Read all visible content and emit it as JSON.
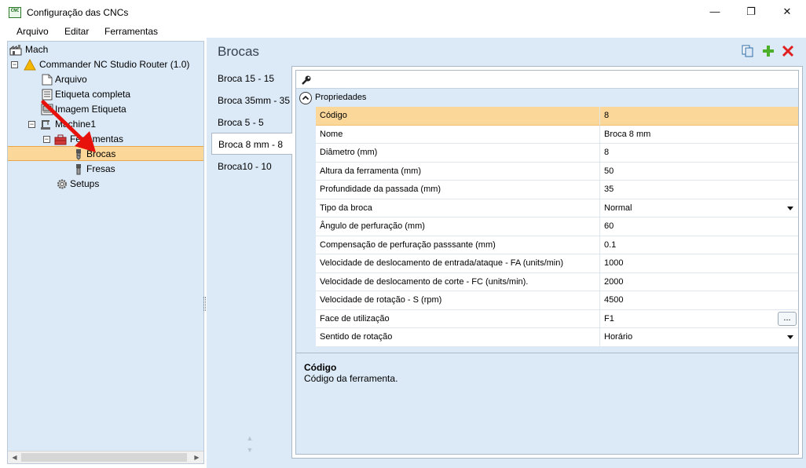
{
  "window": {
    "title": "Configuração das CNCs",
    "app_icon_label": "CNC",
    "minimize": "—",
    "maximize": "❐",
    "close": "✕"
  },
  "menu": {
    "items": [
      "Arquivo",
      "Editar",
      "Ferramentas"
    ]
  },
  "tree": {
    "root": "Mach",
    "machine_group": "Commander NC Studio Router (1.0)",
    "arquivo": "Arquivo",
    "etiqueta_completa": "Etiqueta completa",
    "imagem_etiqueta": "Imagem Etiqueta",
    "machine": "Machine1",
    "ferramentas": "Ferramentas",
    "brocas": "Brocas",
    "fresas": "Fresas",
    "setups": "Setups",
    "expander_minus": "−"
  },
  "header": {
    "title": "Brocas"
  },
  "tabs": [
    {
      "label": "Broca 15 - 15"
    },
    {
      "label": "Broca 35mm - 35"
    },
    {
      "label": "Broca 5 - 5"
    },
    {
      "label": "Broca 8 mm - 8",
      "active": true
    },
    {
      "label": "Broca10 - 10"
    }
  ],
  "property_grid": {
    "section": "Propriedades",
    "rows": [
      {
        "name": "Código",
        "value": "8",
        "selected": true
      },
      {
        "name": "Nome",
        "value": "Broca 8 mm"
      },
      {
        "name": "Diâmetro (mm)",
        "value": "8"
      },
      {
        "name": "Altura da ferramenta (mm)",
        "value": "50"
      },
      {
        "name": "Profundidade da passada (mm)",
        "value": "35"
      },
      {
        "name": "Tipo da broca",
        "value": "Normal",
        "editor": "dropdown"
      },
      {
        "name": "Ângulo de perfuração (mm)",
        "value": "60"
      },
      {
        "name": "Compensação de perfuração passsante (mm)",
        "value": "0.1"
      },
      {
        "name": "Velocidade de deslocamento de entrada/ataque - FA (units/min)",
        "value": "1000"
      },
      {
        "name": "Velocidade de deslocamento de corte - FC (units/min).",
        "value": "2000"
      },
      {
        "name": "Velocidade de rotação - S (rpm)",
        "value": "4500"
      },
      {
        "name": "Face de utilização",
        "value": "F1",
        "editor": "ellipsis"
      },
      {
        "name": "Sentido de rotação",
        "value": "Horário",
        "editor": "dropdown"
      }
    ],
    "ellipsis_label": "...",
    "description": {
      "title": "Código",
      "text": "Código da ferramenta."
    }
  },
  "colors": {
    "panel_bg": "#dce9f6",
    "selection": "#fbd79a",
    "add_icon": "#4caf2a",
    "delete_icon": "#e02020",
    "annotation_arrow": "#e8120c"
  }
}
